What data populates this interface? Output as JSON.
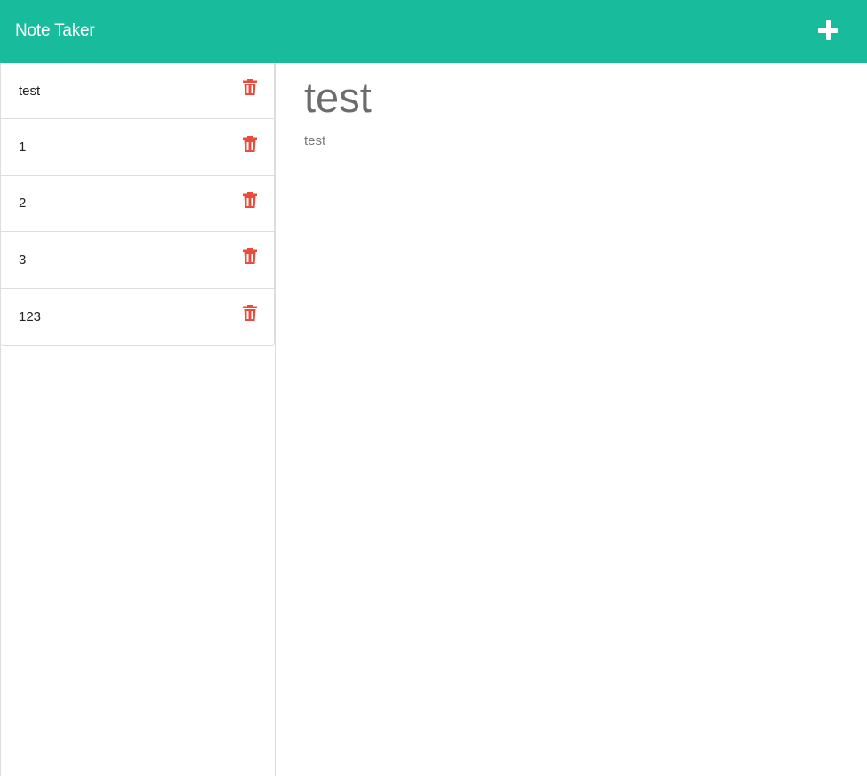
{
  "app": {
    "title": "Note Taker",
    "accent_color": "#18bc9c",
    "danger_color": "#e74c3c"
  },
  "header": {
    "add_icon": "plus-icon"
  },
  "notes": [
    {
      "title": "test",
      "icon": "trash-icon"
    },
    {
      "title": "1",
      "icon": "trash-icon"
    },
    {
      "title": "2",
      "icon": "trash-icon"
    },
    {
      "title": "3",
      "icon": "trash-icon"
    },
    {
      "title": "123",
      "icon": "trash-icon"
    }
  ],
  "active_note": {
    "title": "test",
    "text": "test"
  }
}
